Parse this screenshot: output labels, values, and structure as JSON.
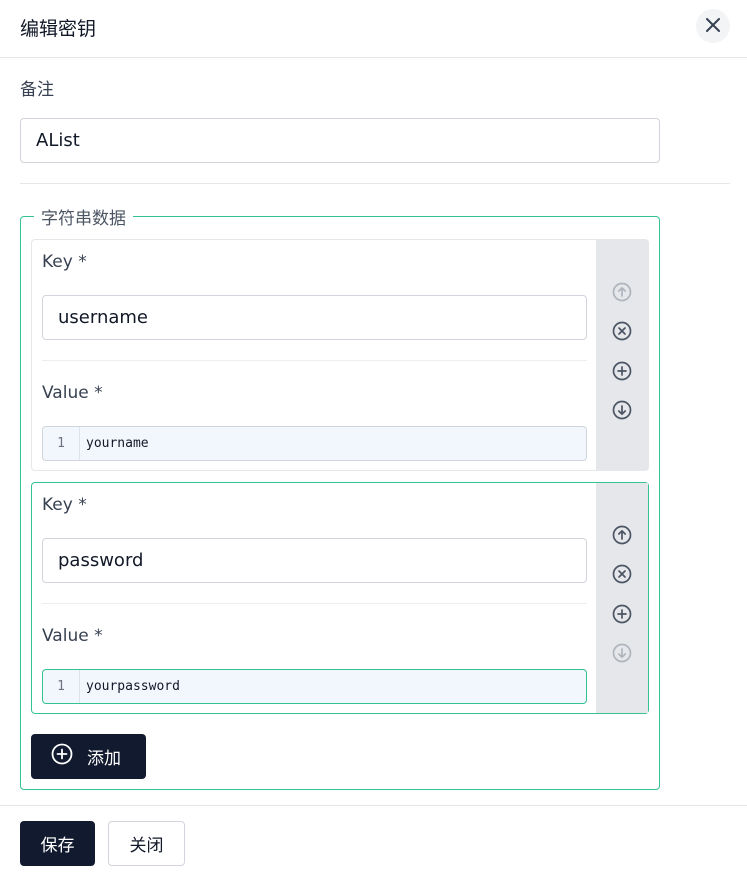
{
  "dialog": {
    "title": "编辑密钥",
    "close_icon": "close-icon"
  },
  "remark": {
    "label": "备注",
    "value": "AList"
  },
  "string_data": {
    "legend": "字符串数据",
    "entries": [
      {
        "key_label": "Key *",
        "key_value": "username",
        "value_label": "Value *",
        "line_number": "1",
        "value_text": "yourname",
        "controls": {
          "move_up": {
            "icon": "arrow-up-circle-icon",
            "enabled": false
          },
          "remove": {
            "icon": "x-circle-icon",
            "enabled": true
          },
          "add": {
            "icon": "plus-circle-icon",
            "enabled": true
          },
          "move_down": {
            "icon": "arrow-down-circle-icon",
            "enabled": true
          }
        }
      },
      {
        "key_label": "Key *",
        "key_value": "password",
        "value_label": "Value *",
        "line_number": "1",
        "value_text": "yourpassword",
        "controls": {
          "move_up": {
            "icon": "arrow-up-circle-icon",
            "enabled": true
          },
          "remove": {
            "icon": "x-circle-icon",
            "enabled": true
          },
          "add": {
            "icon": "plus-circle-icon",
            "enabled": true
          },
          "move_down": {
            "icon": "arrow-down-circle-icon",
            "enabled": false
          }
        }
      }
    ],
    "add_button": "添加",
    "add_icon": "plus-circle-icon"
  },
  "footer": {
    "save_label": "保存",
    "close_label": "关闭"
  },
  "colors": {
    "accent_border": "#34c38f",
    "primary_button": "#111a2e",
    "control_enabled": "#4b5563",
    "control_disabled": "#b0b5bd"
  }
}
